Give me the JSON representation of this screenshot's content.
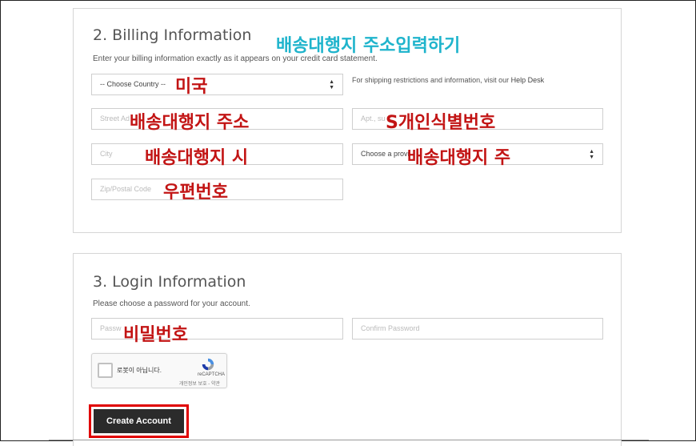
{
  "billing": {
    "title": "2. Billing Information",
    "subtitle": "Enter your billing information exactly as it appears on your credit card statement.",
    "country_select": "-- Choose Country --",
    "shipping_help": "For shipping restrictions and information, visit our",
    "help_desk_link": "Help Desk",
    "street_placeholder": "Street Ad",
    "apt_placeholder": "Apt., su",
    "city_placeholder": "City",
    "province_select": "Choose a provi",
    "zip_placeholder": "Zip/Postal Code"
  },
  "login": {
    "title": "3. Login Information",
    "subtitle": "Please choose a password for your account.",
    "password_placeholder": "Passw",
    "confirm_placeholder": "Confirm Password",
    "create_button": "Create Account"
  },
  "captcha": {
    "label": "로봇이 아닙니다.",
    "brand": "reCAPTCHA",
    "links": "개인정보 보호 - 약관"
  },
  "annotations": {
    "header": "배송대행지 주소입력하기",
    "country": "미국",
    "street": "배송대행지 주소",
    "apt": "S개인식별번호",
    "city": "배송대행지 시",
    "province": "배송대행지 주",
    "zip": "우편번호",
    "password": "비밀번호"
  },
  "colors": {
    "annotation_red": "#c21414",
    "annotation_cyan": "#1fb4cc",
    "button_dark": "#2b2b2b",
    "highlight_red": "#e00000"
  }
}
